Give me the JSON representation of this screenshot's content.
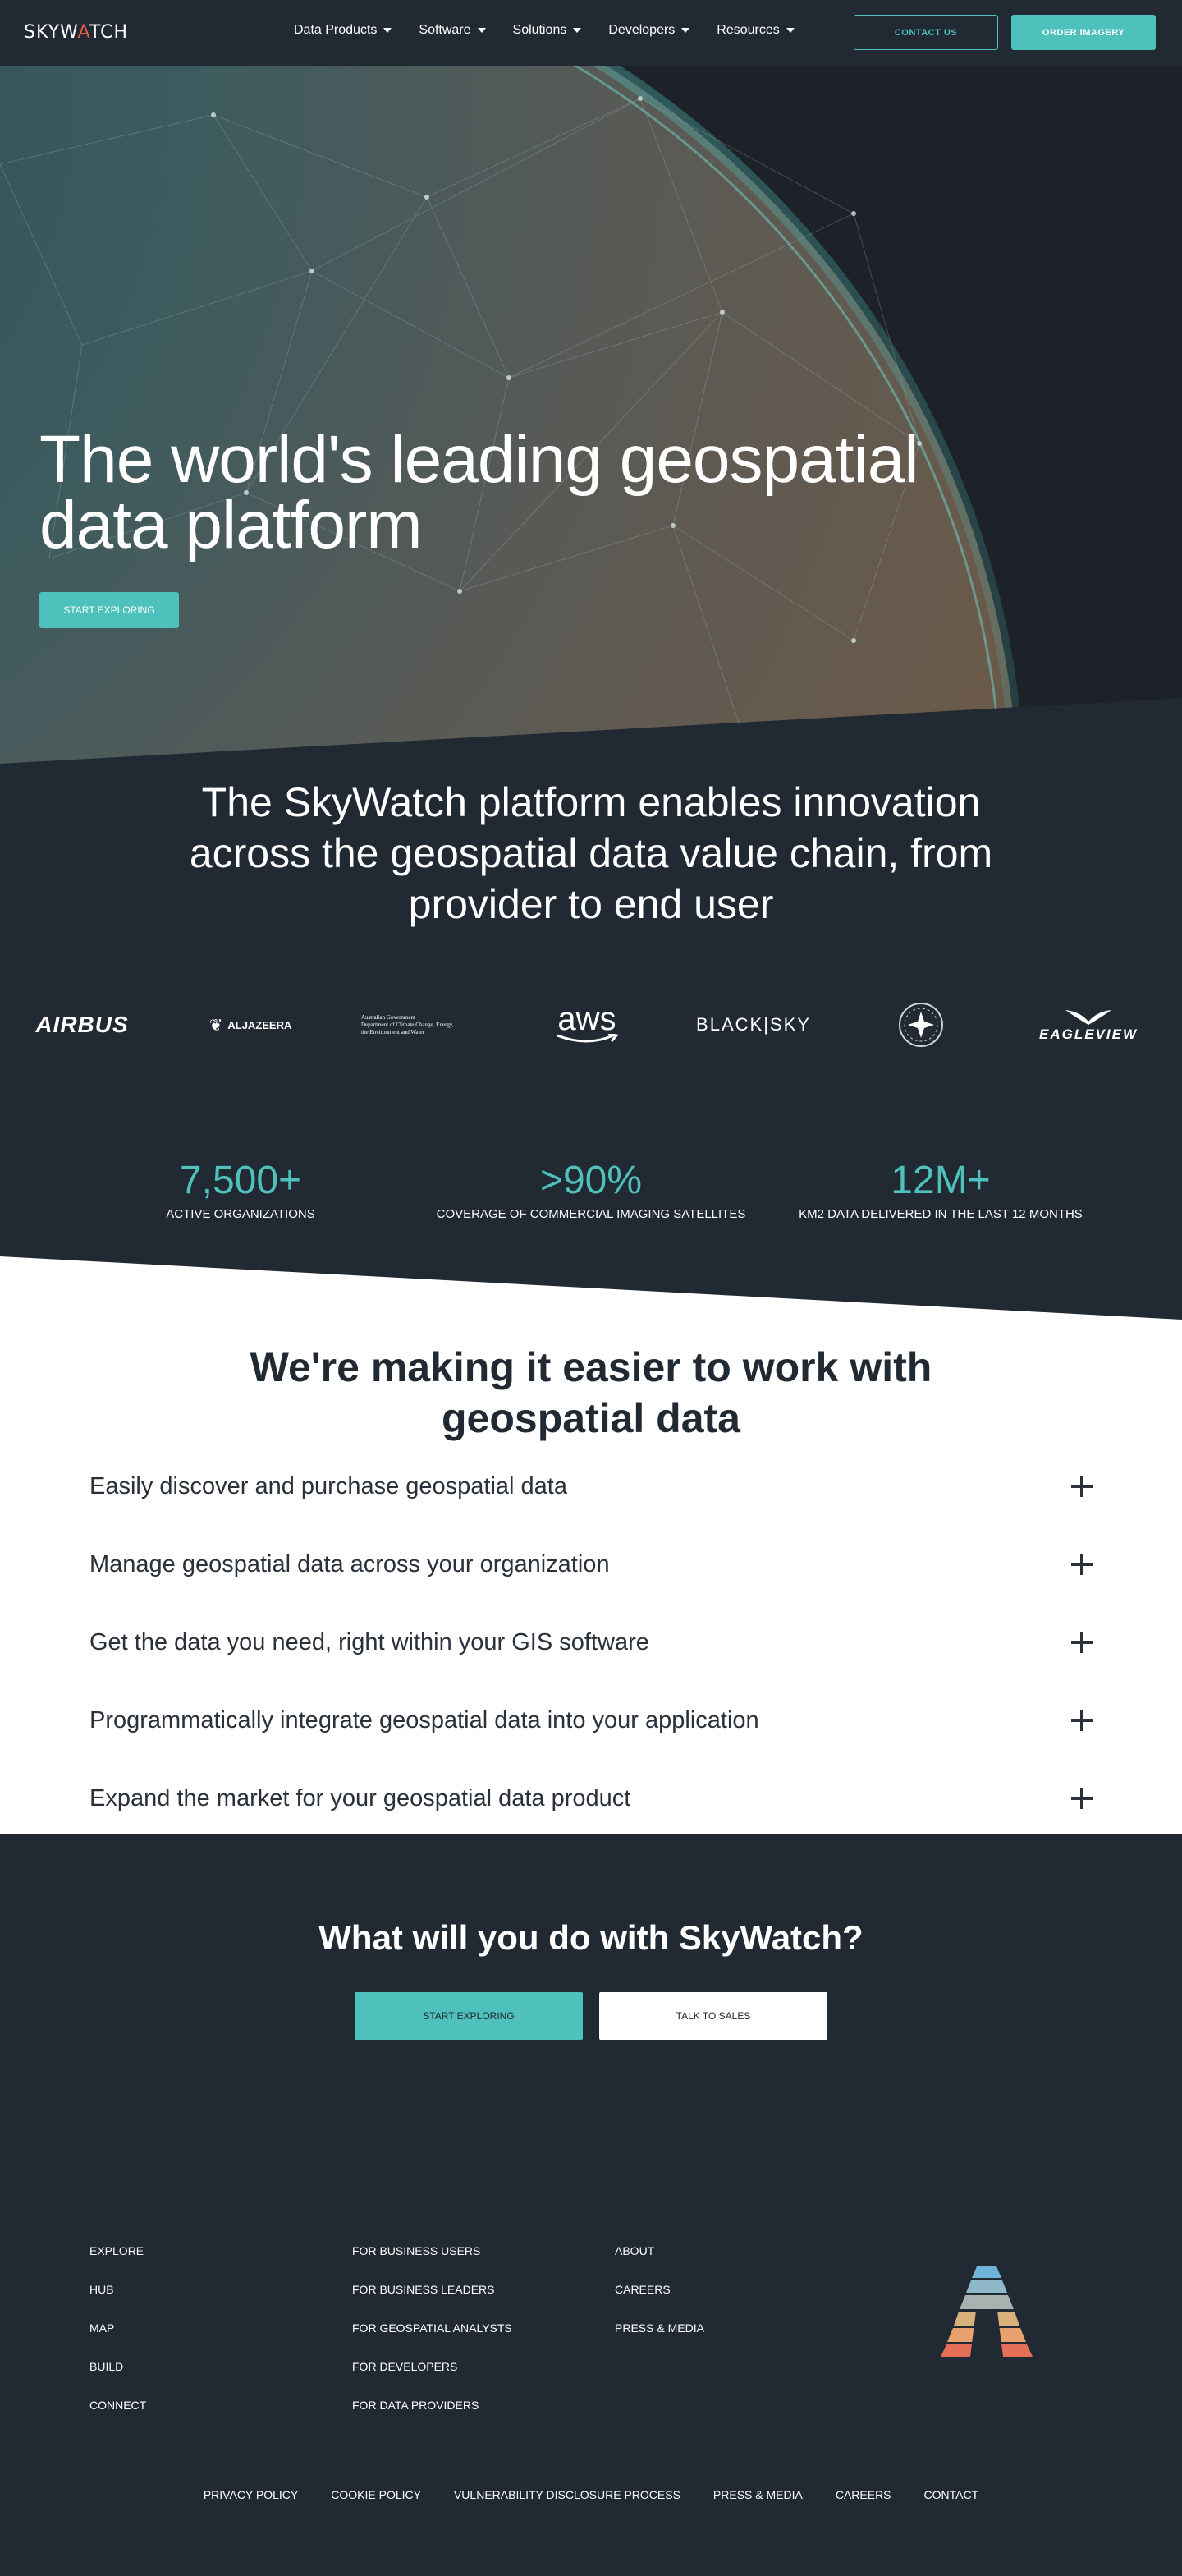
{
  "nav": {
    "logo_pre": "SKYW",
    "logo_a": "A",
    "logo_post": "TCH",
    "menu": [
      "Data Products",
      "Software",
      "Solutions",
      "Developers",
      "Resources"
    ],
    "contact": "CONTACT US",
    "order": "ORDER IMAGERY"
  },
  "hero": {
    "title_line1": "The world's leading geospatial",
    "title_line2": "data platform",
    "button": "START EXPLORING"
  },
  "platform": {
    "title": "The SkyWatch platform enables innovation across the geospatial data value chain, from provider to end user"
  },
  "partners": {
    "airbus": "AIRBUS",
    "aljazeera": "ALJAZEERA",
    "ausgov_line1": "Australian Government",
    "ausgov_line2": "Department of Climate Change, Energy,",
    "ausgov_line3": "the Environment and Water",
    "aws": "aws",
    "blacksky": "BLACK|SKY",
    "eagleview": "EAGLEVIEW"
  },
  "stats": [
    {
      "value": "7,500+",
      "label": "ACTIVE ORGANIZATIONS"
    },
    {
      "value": ">90%",
      "label": "COVERAGE OF COMMERCIAL IMAGING SATELLITES"
    },
    {
      "value": "12M+",
      "label": "KM2 DATA DELIVERED IN THE LAST 12 MONTHS"
    }
  ],
  "features": {
    "title_line1": "We're making it easier to work with",
    "title_line2": "geospatial data",
    "items": [
      "Easily discover and purchase geospatial data",
      "Manage geospatial data across your organization",
      "Get the data you need, right within your GIS software",
      "Programmatically integrate geospatial data into your application",
      "Expand the market for your geospatial data product"
    ]
  },
  "cta": {
    "title": "What will you do with SkyWatch?",
    "explore": "START EXPLORING",
    "sales": "TALK TO SALES"
  },
  "footer": {
    "col1": [
      "EXPLORE",
      "HUB",
      "MAP",
      "BUILD",
      "CONNECT"
    ],
    "col2": [
      "FOR BUSINESS USERS",
      "FOR BUSINESS LEADERS",
      "FOR GEOSPATIAL ANALYSTS",
      "FOR DEVELOPERS",
      "FOR DATA PROVIDERS"
    ],
    "col3": [
      "ABOUT",
      "CAREERS",
      "PRESS & MEDIA"
    ],
    "bottom": [
      "PRIVACY POLICY",
      "COOKIE POLICY",
      "VULNERABILITY DISCLOSURE PROCESS",
      "PRESS & MEDIA",
      "CAREERS",
      "CONTACT"
    ]
  },
  "colors": {
    "accent": "#4fc1bc",
    "dark": "#212933",
    "logo_a": "#e95b45"
  }
}
